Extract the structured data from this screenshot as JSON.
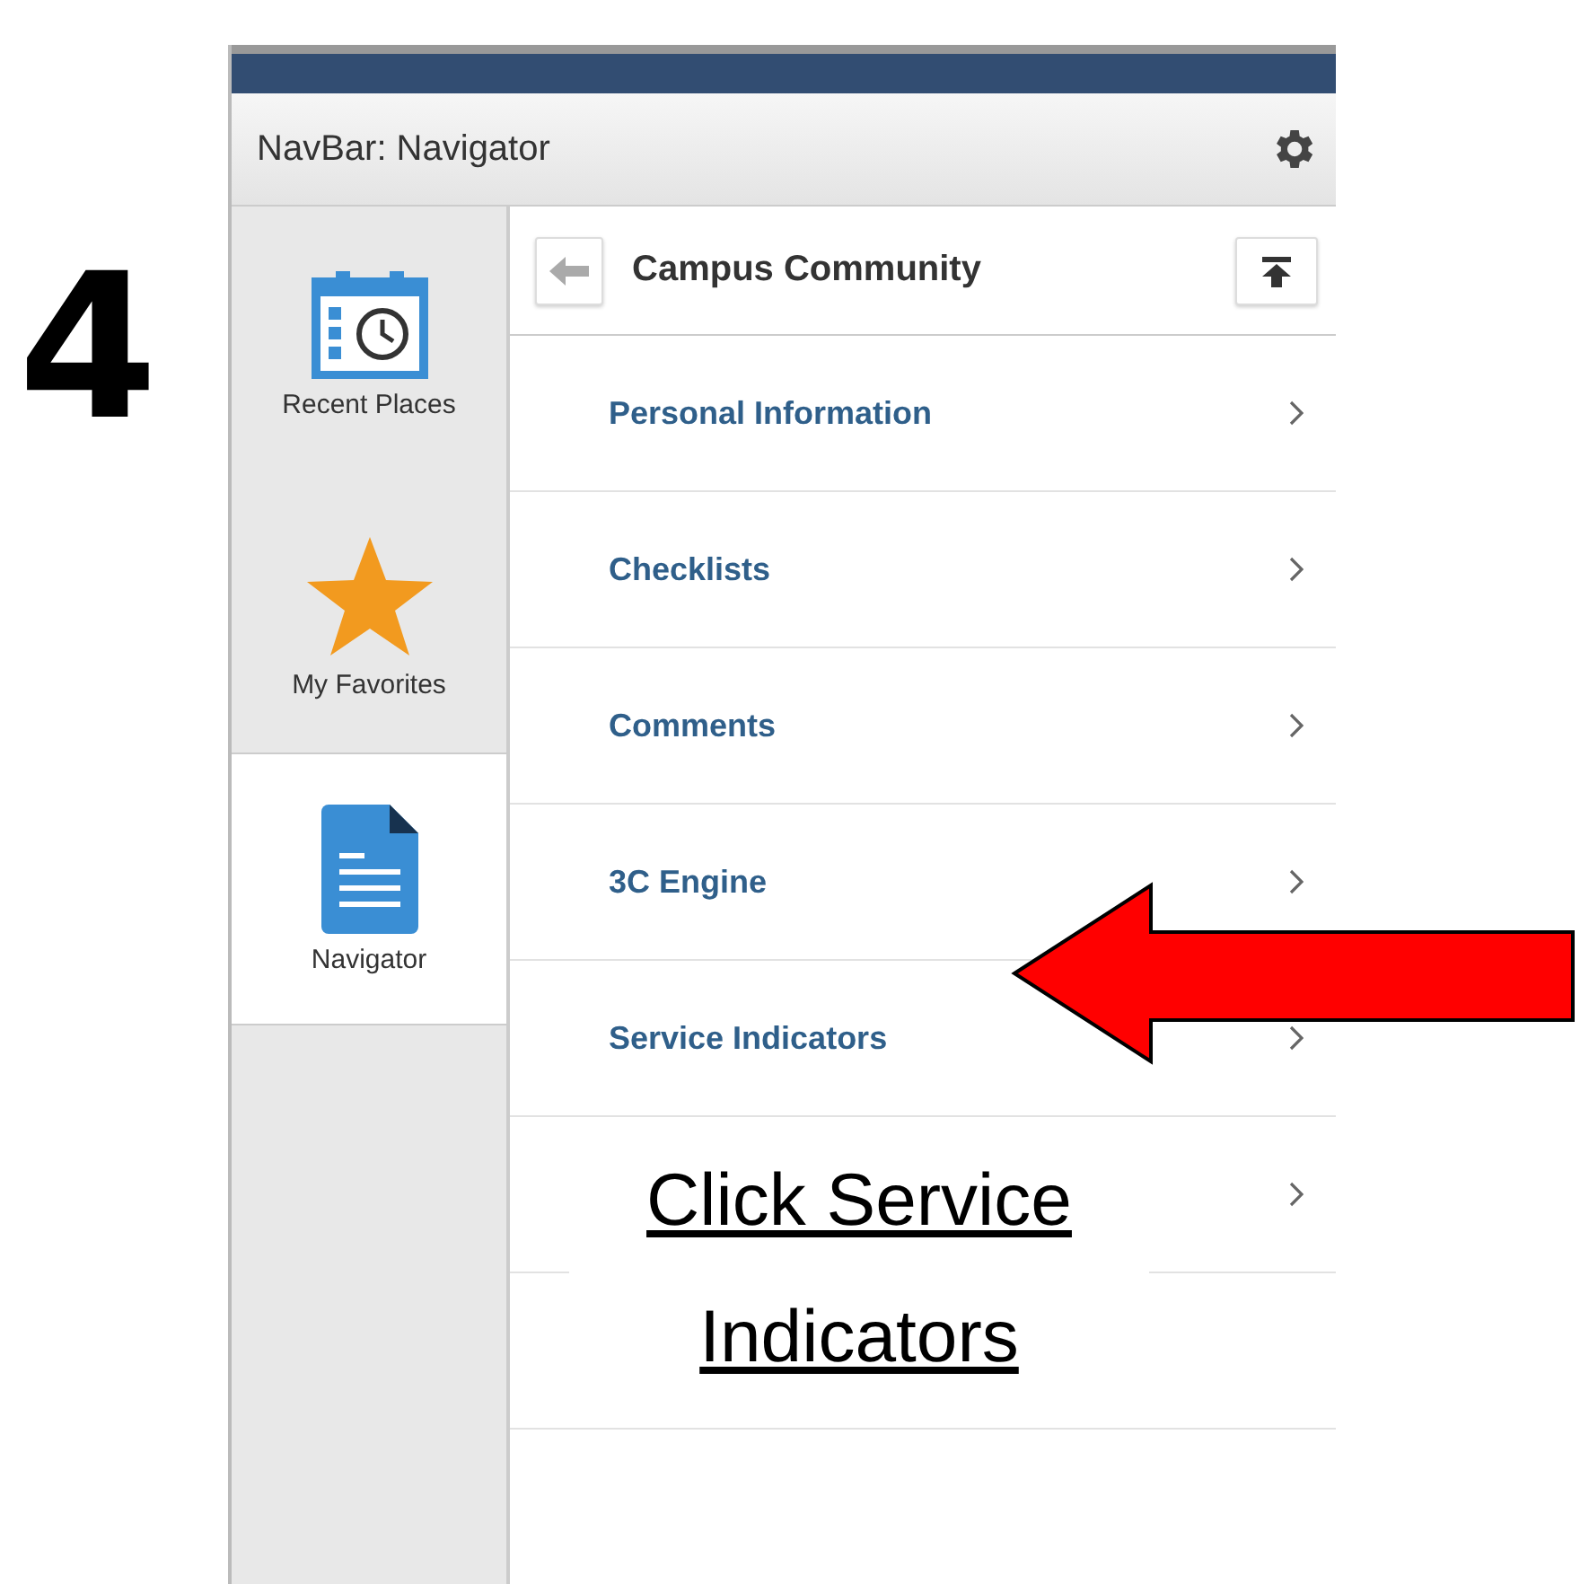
{
  "step": {
    "number": "4"
  },
  "window": {
    "title": "NavBar: Navigator"
  },
  "sidebar": {
    "items": [
      {
        "label": "Recent Places",
        "selected": false
      },
      {
        "label": "My Favorites",
        "selected": false
      },
      {
        "label": "Navigator",
        "selected": true
      }
    ]
  },
  "folder": {
    "title": "Campus Community"
  },
  "items": [
    {
      "kind": "link",
      "label": "Personal Information"
    },
    {
      "kind": "link",
      "label": "Checklists"
    },
    {
      "kind": "link",
      "label": "Comments"
    },
    {
      "kind": "link",
      "label": "3C Engine"
    },
    {
      "kind": "link",
      "label": "Service Indicators"
    },
    {
      "kind": "covered"
    },
    {
      "kind": "empty"
    }
  ],
  "callout": {
    "text": "Click Service Indicators"
  }
}
